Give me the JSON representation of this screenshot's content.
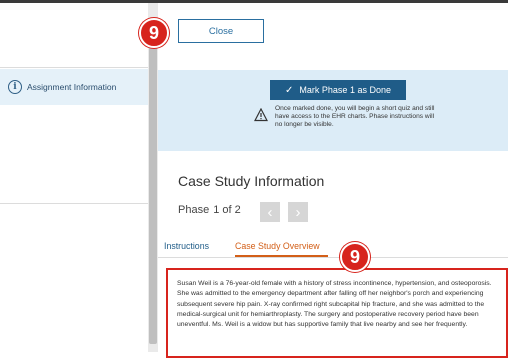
{
  "left_panel": {
    "nav_item_label": "Assignment Information",
    "info_icon": "i"
  },
  "header": {
    "close_label": "Close"
  },
  "mark_done": {
    "check_icon": "✓",
    "button_label": "Mark Phase 1 as Done",
    "warning_text": "Once marked done, you will begin a short quiz and still have access to the EHR charts. Phase instructions will no longer be visible."
  },
  "case_study": {
    "title": "Case Study Information",
    "phase_label": "Phase",
    "phase_value": "1 of 2",
    "prev_icon": "‹",
    "next_icon": "›",
    "tabs": [
      {
        "label": "Instructions"
      },
      {
        "label": "Case Study Overview"
      }
    ],
    "overview_text": "Susan Weil is a 76-year-old female with a history of stress incontinence, hypertension, and osteoporosis. She was admitted to the emergency department after falling off her neighbor's porch and experiencing subsequent severe hip pain. X-ray confirmed right subcapital hip fracture, and she was admitted to the medical-surgical unit for hemiarthroplasty. The surgery and postoperative recovery period have been uneventful. Ms. Weil is a widow but has supportive family that live nearby and see her frequently."
  },
  "annotations": {
    "step_number_1": "9",
    "step_number_2": "9"
  },
  "colors": {
    "accent": "#1f5c88",
    "active_tab": "#d35f18",
    "highlight": "#d7241d",
    "panel_bg": "#dcecf7"
  }
}
